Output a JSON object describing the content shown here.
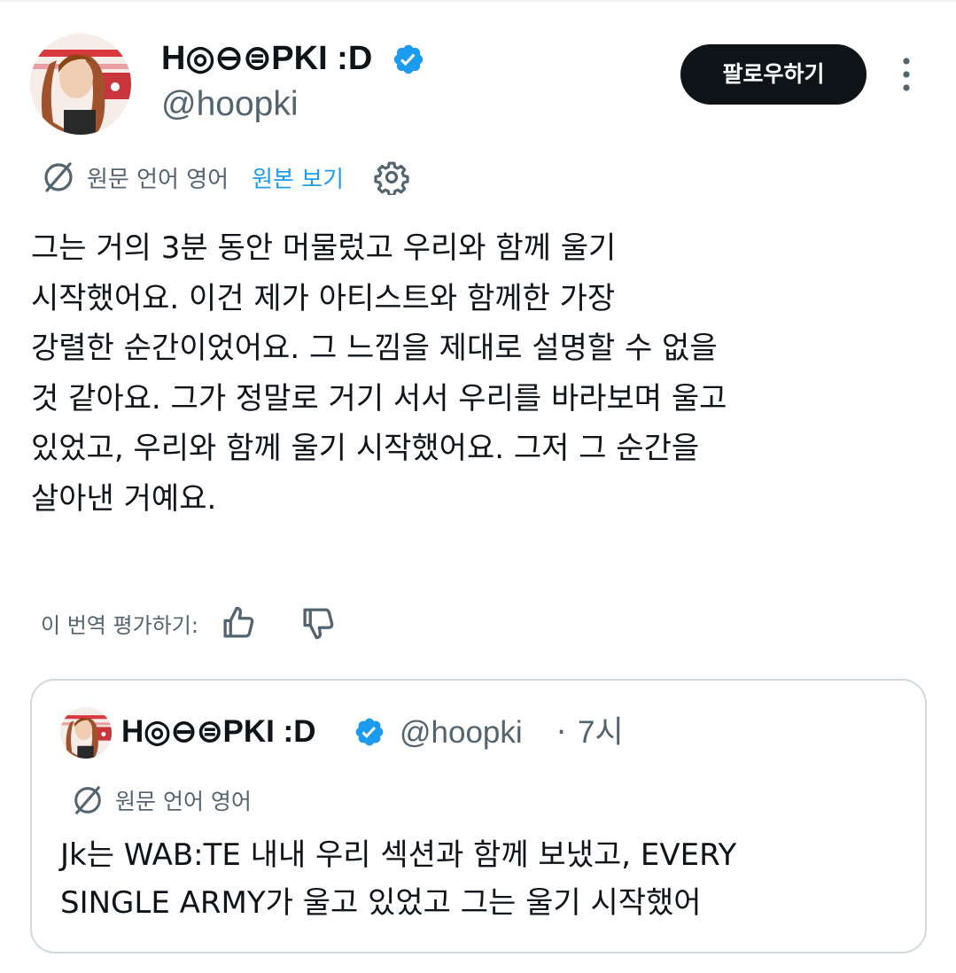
{
  "tweet": {
    "author": {
      "name": "H◎⊖⊜PKI :D",
      "handle": "@hoopki",
      "verified": true
    },
    "follow_label": "팔로우하기",
    "translation": {
      "source_label": "원문 언어 영어",
      "view_original": "원본 보기"
    },
    "body_lines": [
      "그는 거의 3분 동안 머물렀고 우리와 함께 울기",
      "시작했어요. 이건 제가 아티스트와 함께한 가장",
      "강렬한 순간이었어요. 그 느낌을 제대로 설명할 수 없을",
      "것 같아요. 그가 정말로 거기 서서 우리를 바라보며 울고",
      "있었고, 우리와 함께 울기 시작했어요. 그저 그 순간을",
      "살아낸 거예요."
    ],
    "rate_label": "이 번역 평가하기:"
  },
  "quote": {
    "author": {
      "name": "H◎⊖⊜PKI :D",
      "handle": "@hoopki",
      "verified": true
    },
    "separator": "·",
    "time": "7시",
    "translation": {
      "source_label": "원문 언어 영어"
    },
    "body_lines": [
      "Jk는 WAB:TE 내내 우리 섹션과 함께 보냈고, EVERY",
      "SINGLE ARMY가 울고 있었고 그는 울기 시작했어"
    ]
  },
  "colors": {
    "text": "#0f1419",
    "secondary": "#536471",
    "link": "#1d9bf0",
    "verified": "#1d9bf0",
    "border": "#cfd9de",
    "button_bg": "#0f1419"
  },
  "icons": [
    "verified-badge-icon",
    "more-options-icon",
    "translate-icon",
    "gear-icon",
    "thumbs-up-icon",
    "thumbs-down-icon"
  ]
}
